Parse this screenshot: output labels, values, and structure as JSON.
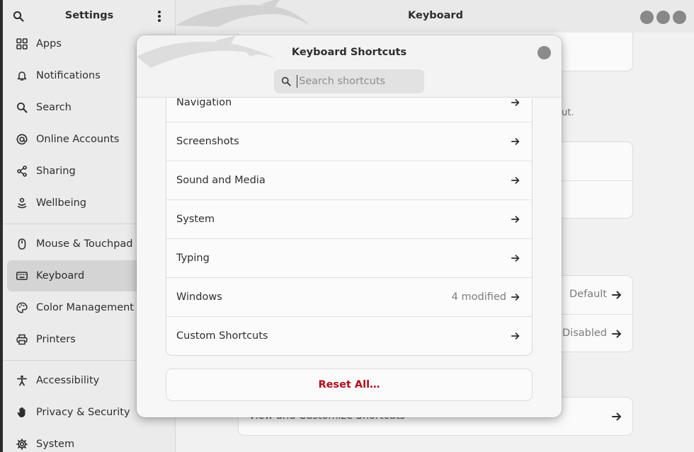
{
  "sidebar": {
    "title": "Settings",
    "search_icon": "search-icon",
    "menu_icon": "kebab-menu-icon",
    "items": [
      {
        "label": "Apps",
        "icon": "apps-grid-icon"
      },
      {
        "label": "Notifications",
        "icon": "bell-icon"
      },
      {
        "label": "Search",
        "icon": "search-icon"
      },
      {
        "label": "Online Accounts",
        "icon": "at-sign-icon"
      },
      {
        "label": "Sharing",
        "icon": "share-icon"
      },
      {
        "label": "Wellbeing",
        "icon": "wellbeing-icon"
      },
      {
        "label": "Mouse & Touchpad",
        "icon": "mouse-icon"
      },
      {
        "label": "Keyboard",
        "icon": "keyboard-icon"
      },
      {
        "label": "Color Management",
        "icon": "palette-icon"
      },
      {
        "label": "Printers",
        "icon": "printer-icon"
      },
      {
        "label": "Accessibility",
        "icon": "accessibility-icon"
      },
      {
        "label": "Privacy & Security",
        "icon": "hand-icon"
      },
      {
        "label": "System",
        "icon": "gear-icon"
      }
    ],
    "active": "Keyboard"
  },
  "main": {
    "title": "Keyboard",
    "bg_text_fragment": "ut.",
    "bg_value_default": "Default",
    "bg_value_disabled": "Disabled",
    "bg_view_shortcuts": "View and Customize Shortcuts"
  },
  "dialog": {
    "title": "Keyboard Shortcuts",
    "search_placeholder": "Search shortcuts",
    "rows": [
      {
        "label": "Navigation",
        "meta": ""
      },
      {
        "label": "Screenshots",
        "meta": ""
      },
      {
        "label": "Sound and Media",
        "meta": ""
      },
      {
        "label": "System",
        "meta": ""
      },
      {
        "label": "Typing",
        "meta": ""
      },
      {
        "label": "Windows",
        "meta": "4 modified"
      },
      {
        "label": "Custom Shortcuts",
        "meta": ""
      }
    ],
    "reset_label": "Reset All…"
  },
  "colors": {
    "destructive": "#b30a1a",
    "sidebar_bg": "#ebebeb",
    "active_item": "#d4d4d4"
  }
}
